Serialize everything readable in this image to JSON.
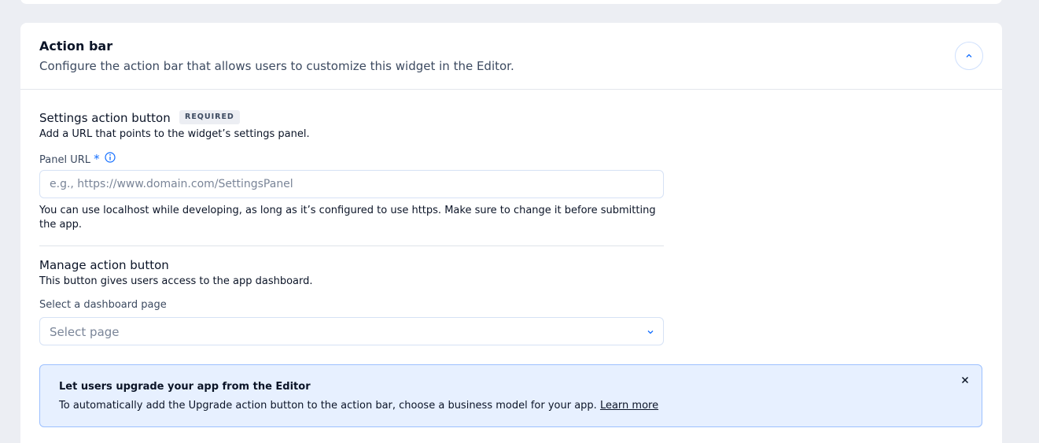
{
  "action_bar": {
    "title": "Action bar",
    "subtitle": "Configure the action bar that allows users to customize this widget in the Editor."
  },
  "settings_button": {
    "title": "Settings action button",
    "badge": "REQUIRED",
    "description": "Add a URL that points to the widget’s settings panel.",
    "field_label": "Panel URL",
    "required_marker": "*",
    "placeholder": "e.g., https://www.domain.com/SettingsPanel",
    "value": "",
    "help_text": "You can use localhost while developing, as long as it’s configured to use https. Make sure to change it before submitting the app."
  },
  "manage_button": {
    "title": "Manage action button",
    "description": "This button gives users access to the app dashboard.",
    "field_label": "Select a dashboard page",
    "select_value": "Select page"
  },
  "notice": {
    "title": "Let users upgrade your app from the Editor",
    "text": "To automatically add the Upgrade action button to the action bar, choose a business model for your app.",
    "link": "Learn more"
  },
  "icons": {
    "collapse": "chevron-up-icon",
    "info": "info-icon",
    "dropdown": "chevron-down-icon",
    "close": "close-icon"
  },
  "colors": {
    "accent": "#116dff",
    "notice_bg": "#e7f0ff",
    "notice_border": "#9cc0ff",
    "page_bg": "#eceef3"
  }
}
